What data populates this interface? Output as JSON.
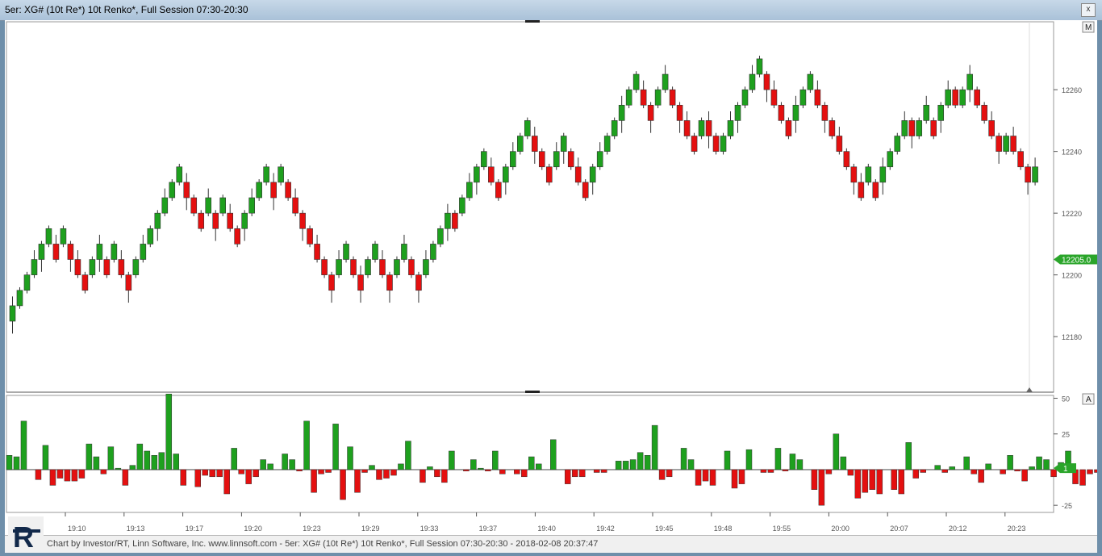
{
  "window": {
    "title": "5er: XG# (10t Re*) 10t Renko*, Full Session 07:30-20:30",
    "close_label": "x"
  },
  "footer": {
    "text": "Chart by Investor/RT, Linn Software, Inc. www.linnsoft.com - 5er: XG# (10t Re*) 10t Renko*, Full Session 07:30-20:30 - 2018-02-08 20:37:47"
  },
  "logo": {
    "letter": "R"
  },
  "chart_data": [
    {
      "type": "renko",
      "title": "5er: XG# (10t Re*) 10t Renko*, Full Session 07:30-20:30",
      "ylim": [
        12162,
        12282
      ],
      "y_ticks": [
        12180,
        12200,
        12220,
        12240,
        12260
      ],
      "last_price": "12205.0",
      "panel_button": "M",
      "up_color": "#1ea01e",
      "down_color": "#e41010",
      "x_tick_labels": [
        "19:10",
        "19:13",
        "19:17",
        "19:20",
        "19:23",
        "19:29",
        "19:33",
        "19:37",
        "19:40",
        "19:42",
        "19:45",
        "19:48",
        "19:55",
        "20:00",
        "20:07",
        "20:12",
        "20:23"
      ],
      "bricks": [
        {
          "close": 12190,
          "dir": "up"
        },
        {
          "close": 12195,
          "dir": "up"
        },
        {
          "close": 12200,
          "dir": "up"
        },
        {
          "close": 12205,
          "dir": "up"
        },
        {
          "close": 12210,
          "dir": "up"
        },
        {
          "close": 12215,
          "dir": "up"
        },
        {
          "close": 12205,
          "dir": "down"
        },
        {
          "close": 12215,
          "dir": "up"
        },
        {
          "close": 12205,
          "dir": "down"
        },
        {
          "close": 12200,
          "dir": "down"
        },
        {
          "close": 12195,
          "dir": "down"
        },
        {
          "close": 12205,
          "dir": "up"
        },
        {
          "close": 12210,
          "dir": "up"
        },
        {
          "close": 12200,
          "dir": "down"
        },
        {
          "close": 12210,
          "dir": "up"
        },
        {
          "close": 12200,
          "dir": "down"
        },
        {
          "close": 12195,
          "dir": "down"
        },
        {
          "close": 12205,
          "dir": "up"
        },
        {
          "close": 12210,
          "dir": "up"
        },
        {
          "close": 12215,
          "dir": "up"
        },
        {
          "close": 12220,
          "dir": "up"
        },
        {
          "close": 12225,
          "dir": "up"
        },
        {
          "close": 12230,
          "dir": "up"
        },
        {
          "close": 12235,
          "dir": "up"
        },
        {
          "close": 12225,
          "dir": "down"
        },
        {
          "close": 12220,
          "dir": "down"
        },
        {
          "close": 12215,
          "dir": "down"
        },
        {
          "close": 12225,
          "dir": "up"
        },
        {
          "close": 12215,
          "dir": "down"
        },
        {
          "close": 12225,
          "dir": "up"
        },
        {
          "close": 12215,
          "dir": "down"
        },
        {
          "close": 12210,
          "dir": "down"
        },
        {
          "close": 12220,
          "dir": "up"
        },
        {
          "close": 12225,
          "dir": "up"
        },
        {
          "close": 12230,
          "dir": "up"
        },
        {
          "close": 12235,
          "dir": "up"
        },
        {
          "close": 12225,
          "dir": "down"
        },
        {
          "close": 12235,
          "dir": "up"
        },
        {
          "close": 12225,
          "dir": "down"
        },
        {
          "close": 12220,
          "dir": "down"
        },
        {
          "close": 12215,
          "dir": "down"
        },
        {
          "close": 12210,
          "dir": "down"
        },
        {
          "close": 12205,
          "dir": "down"
        },
        {
          "close": 12200,
          "dir": "down"
        },
        {
          "close": 12195,
          "dir": "down"
        },
        {
          "close": 12205,
          "dir": "up"
        },
        {
          "close": 12210,
          "dir": "up"
        },
        {
          "close": 12200,
          "dir": "down"
        },
        {
          "close": 12195,
          "dir": "down"
        },
        {
          "close": 12205,
          "dir": "up"
        },
        {
          "close": 12210,
          "dir": "up"
        },
        {
          "close": 12200,
          "dir": "down"
        },
        {
          "close": 12195,
          "dir": "down"
        },
        {
          "close": 12205,
          "dir": "up"
        },
        {
          "close": 12210,
          "dir": "up"
        },
        {
          "close": 12200,
          "dir": "down"
        },
        {
          "close": 12195,
          "dir": "down"
        },
        {
          "close": 12205,
          "dir": "up"
        },
        {
          "close": 12210,
          "dir": "up"
        },
        {
          "close": 12215,
          "dir": "up"
        },
        {
          "close": 12220,
          "dir": "up"
        },
        {
          "close": 12215,
          "dir": "down"
        },
        {
          "close": 12225,
          "dir": "up"
        },
        {
          "close": 12230,
          "dir": "up"
        },
        {
          "close": 12235,
          "dir": "up"
        },
        {
          "close": 12240,
          "dir": "up"
        },
        {
          "close": 12230,
          "dir": "down"
        },
        {
          "close": 12225,
          "dir": "down"
        },
        {
          "close": 12235,
          "dir": "up"
        },
        {
          "close": 12240,
          "dir": "up"
        },
        {
          "close": 12245,
          "dir": "up"
        },
        {
          "close": 12250,
          "dir": "up"
        },
        {
          "close": 12240,
          "dir": "down"
        },
        {
          "close": 12235,
          "dir": "down"
        },
        {
          "close": 12230,
          "dir": "down"
        },
        {
          "close": 12240,
          "dir": "up"
        },
        {
          "close": 12245,
          "dir": "up"
        },
        {
          "close": 12235,
          "dir": "down"
        },
        {
          "close": 12230,
          "dir": "down"
        },
        {
          "close": 12225,
          "dir": "down"
        },
        {
          "close": 12235,
          "dir": "up"
        },
        {
          "close": 12240,
          "dir": "up"
        },
        {
          "close": 12245,
          "dir": "up"
        },
        {
          "close": 12250,
          "dir": "up"
        },
        {
          "close": 12255,
          "dir": "up"
        },
        {
          "close": 12260,
          "dir": "up"
        },
        {
          "close": 12265,
          "dir": "up"
        },
        {
          "close": 12255,
          "dir": "down"
        },
        {
          "close": 12250,
          "dir": "down"
        },
        {
          "close": 12260,
          "dir": "up"
        },
        {
          "close": 12265,
          "dir": "up"
        },
        {
          "close": 12255,
          "dir": "down"
        },
        {
          "close": 12250,
          "dir": "down"
        },
        {
          "close": 12245,
          "dir": "down"
        },
        {
          "close": 12240,
          "dir": "down"
        },
        {
          "close": 12250,
          "dir": "up"
        },
        {
          "close": 12245,
          "dir": "down"
        },
        {
          "close": 12240,
          "dir": "down"
        },
        {
          "close": 12245,
          "dir": "up"
        },
        {
          "close": 12250,
          "dir": "up"
        },
        {
          "close": 12255,
          "dir": "up"
        },
        {
          "close": 12260,
          "dir": "up"
        },
        {
          "close": 12265,
          "dir": "up"
        },
        {
          "close": 12270,
          "dir": "up"
        },
        {
          "close": 12260,
          "dir": "down"
        },
        {
          "close": 12255,
          "dir": "down"
        },
        {
          "close": 12250,
          "dir": "down"
        },
        {
          "close": 12245,
          "dir": "down"
        },
        {
          "close": 12255,
          "dir": "up"
        },
        {
          "close": 12260,
          "dir": "up"
        },
        {
          "close": 12265,
          "dir": "up"
        },
        {
          "close": 12255,
          "dir": "down"
        },
        {
          "close": 12250,
          "dir": "down"
        },
        {
          "close": 12245,
          "dir": "down"
        },
        {
          "close": 12240,
          "dir": "down"
        },
        {
          "close": 12235,
          "dir": "down"
        },
        {
          "close": 12230,
          "dir": "down"
        },
        {
          "close": 12225,
          "dir": "down"
        },
        {
          "close": 12235,
          "dir": "up"
        },
        {
          "close": 12225,
          "dir": "down"
        },
        {
          "close": 12235,
          "dir": "up"
        },
        {
          "close": 12240,
          "dir": "up"
        },
        {
          "close": 12245,
          "dir": "up"
        },
        {
          "close": 12250,
          "dir": "up"
        },
        {
          "close": 12245,
          "dir": "down"
        },
        {
          "close": 12250,
          "dir": "up"
        },
        {
          "close": 12255,
          "dir": "up"
        },
        {
          "close": 12245,
          "dir": "down"
        },
        {
          "close": 12255,
          "dir": "up"
        },
        {
          "close": 12260,
          "dir": "up"
        },
        {
          "close": 12255,
          "dir": "down"
        },
        {
          "close": 12260,
          "dir": "up"
        },
        {
          "close": 12265,
          "dir": "up"
        },
        {
          "close": 12255,
          "dir": "down"
        },
        {
          "close": 12250,
          "dir": "down"
        },
        {
          "close": 12245,
          "dir": "down"
        },
        {
          "close": 12240,
          "dir": "down"
        },
        {
          "close": 12245,
          "dir": "up"
        },
        {
          "close": 12240,
          "dir": "down"
        },
        {
          "close": 12235,
          "dir": "down"
        },
        {
          "close": 12230,
          "dir": "down"
        },
        {
          "close": 12235,
          "dir": "up"
        }
      ]
    },
    {
      "type": "bar",
      "ylim": [
        -30,
        52
      ],
      "y_ticks": [
        50,
        25,
        -25
      ],
      "last_value": "1",
      "panel_button": "A",
      "values": [
        10,
        9,
        34,
        0,
        -7,
        17,
        -11,
        -6,
        -8,
        -8,
        -6,
        18,
        9,
        -3,
        16,
        1,
        -11,
        3,
        18,
        13,
        10,
        12,
        53,
        11,
        -11,
        0,
        -12,
        -4,
        -5,
        -5,
        -17,
        15,
        -3,
        -10,
        -5,
        7,
        4,
        0,
        11,
        7,
        -1,
        34,
        -16,
        -3,
        -2,
        32,
        -21,
        16,
        -16,
        -2,
        3,
        -7,
        -6,
        -4,
        4,
        20,
        0,
        -9,
        2,
        -5,
        -9,
        13,
        0,
        -1,
        7,
        1,
        -1,
        13,
        -3,
        0,
        -3,
        -5,
        9,
        4,
        0,
        21,
        0,
        -10,
        -5,
        -5,
        0,
        -2,
        -2,
        0,
        6,
        6,
        7,
        12,
        10,
        31,
        -7,
        -5,
        0,
        15,
        7,
        -11,
        -8,
        -11,
        0,
        13,
        -13,
        -10,
        14,
        0,
        -2,
        -2,
        15,
        -1,
        11,
        7,
        0,
        -14,
        -25,
        -3,
        25,
        9,
        -4,
        -20,
        -16,
        -14,
        -17,
        0,
        -14,
        -17,
        19,
        -6,
        -2,
        0,
        3,
        -2,
        2,
        0,
        9,
        -3,
        -9,
        4,
        0,
        -3,
        10,
        -1,
        -8,
        2,
        9,
        7,
        -5,
        5,
        13,
        -10,
        -11,
        -3,
        -2,
        -1,
        1
      ]
    }
  ]
}
